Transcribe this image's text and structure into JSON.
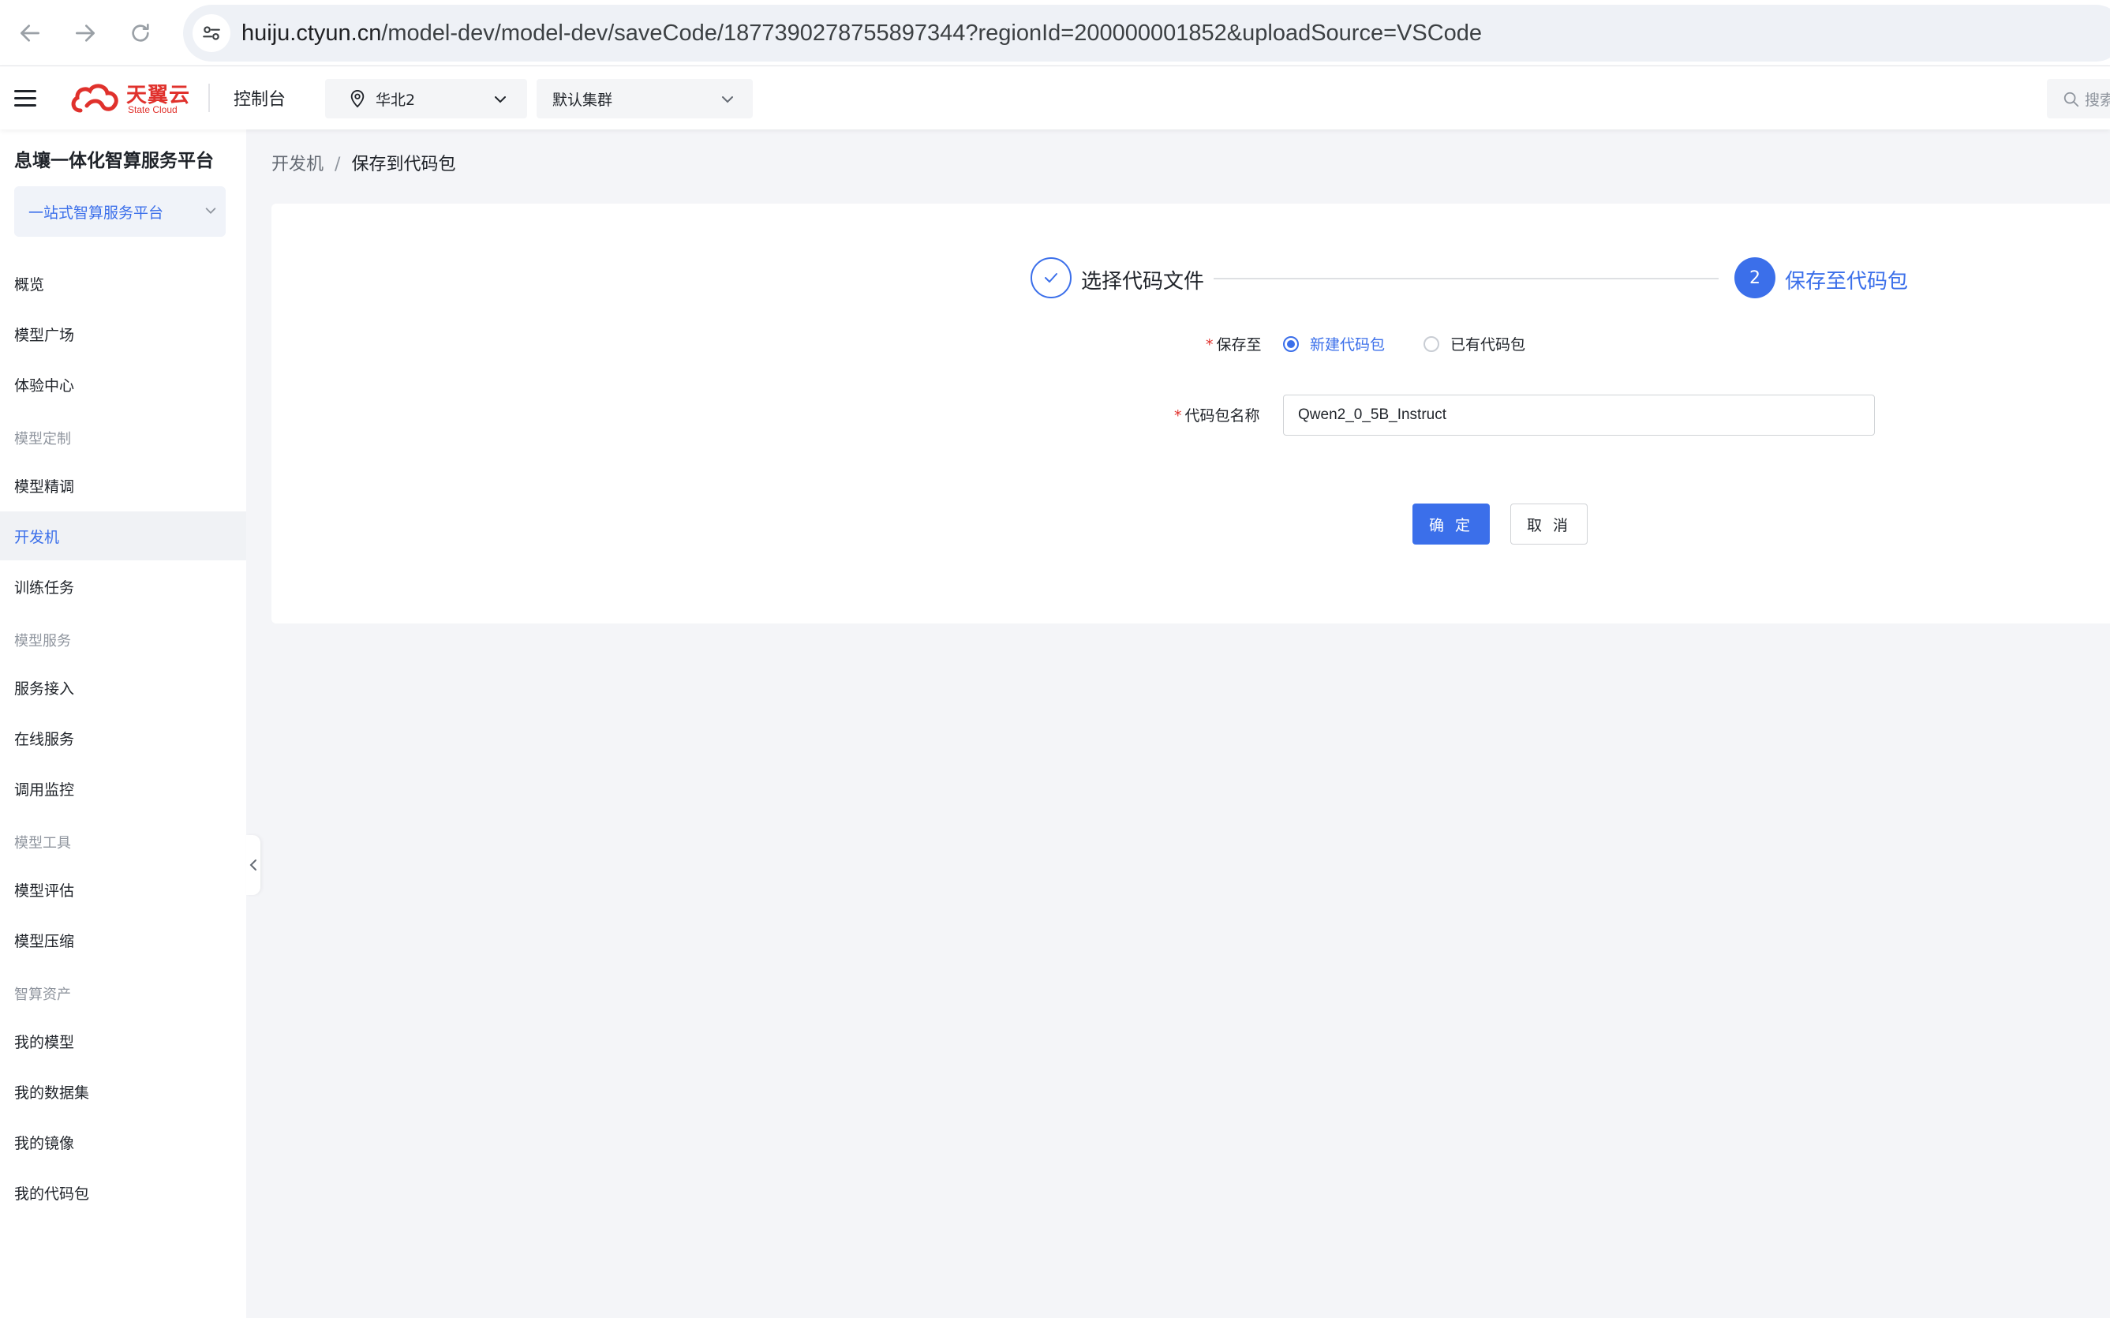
{
  "browser": {
    "url_host": "huiju.ctyun.cn",
    "url_path": "/model-dev/model-dev/saveCode/1877390278755897344?regionId=200000001852&uploadSource=VSCode"
  },
  "header": {
    "logo_cn": "天翼云",
    "logo_en": "State Cloud",
    "console": "控制台",
    "region": "华北2",
    "cluster": "默认集群",
    "search_placeholder": "搜索"
  },
  "sidebar": {
    "title": "息壤一体化智算服务平台",
    "platform_select": "一站式智算服务平台",
    "items": {
      "overview": "概览",
      "model_plaza": "模型广场",
      "experience": "体验中心",
      "group_custom": "模型定制",
      "finetune": "模型精调",
      "devbox": "开发机",
      "training": "训练任务",
      "group_service": "模型服务",
      "service_access": "服务接入",
      "online_service": "在线服务",
      "monitor": "调用监控",
      "group_tools": "模型工具",
      "evaluate": "模型评估",
      "compress": "模型压缩",
      "group_assets": "智算资产",
      "my_models": "我的模型",
      "my_datasets": "我的数据集",
      "my_images": "我的镜像",
      "my_codepacks": "我的代码包"
    }
  },
  "breadcrumb": {
    "parent": "开发机",
    "separator": "/",
    "current": "保存到代码包"
  },
  "steps": {
    "step1_label": "选择代码文件",
    "step2_number": "2",
    "step2_label": "保存至代码包"
  },
  "form": {
    "save_to_label": "保存至",
    "required_mark": "*",
    "option_new": "新建代码包",
    "option_existing": "已有代码包",
    "name_label": "代码包名称",
    "name_value": "Qwen2_0_5B_Instruct",
    "confirm": "确 定",
    "cancel": "取 消"
  },
  "colors": {
    "accent": "#3b6fea",
    "brand": "#e0312c"
  }
}
